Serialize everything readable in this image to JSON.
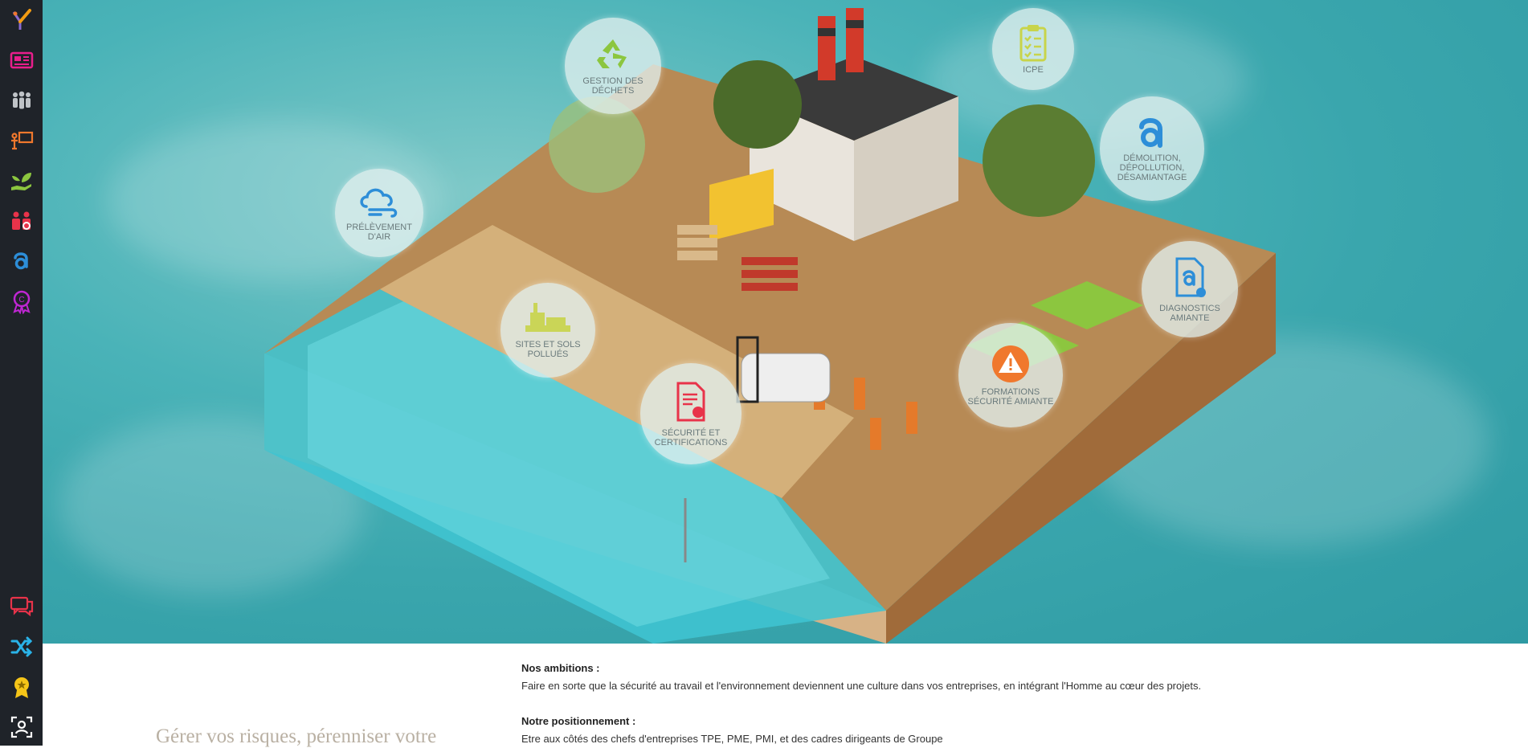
{
  "sidebar": {
    "items": [
      {
        "icon": "logo-icon",
        "color": "#f39c12"
      },
      {
        "icon": "newspaper-icon",
        "color": "#e91e8c"
      },
      {
        "icon": "team-icon",
        "color": "#bfc3c7"
      },
      {
        "icon": "presentation-icon",
        "color": "#f0782d"
      },
      {
        "icon": "plant-hand-icon",
        "color": "#8cc63f"
      },
      {
        "icon": "safety-group-icon",
        "color": "#e8334a"
      },
      {
        "icon": "asbestos-a-icon",
        "color": "#2d8ed8"
      },
      {
        "icon": "certification-badge-icon",
        "color": "#c026d3"
      },
      {
        "icon": "chat-icon",
        "color": "#e8334a"
      },
      {
        "icon": "shuffle-icon",
        "color": "#2ab3e8"
      },
      {
        "icon": "award-medal-icon",
        "color": "#f5c518"
      },
      {
        "icon": "profile-frame-icon",
        "color": "#ffffff"
      }
    ]
  },
  "hero": {
    "bubbles": [
      {
        "key": "dechets",
        "label": "GESTION DES DÉCHETS",
        "icon": "recycle-icon",
        "color": "#8cc63f"
      },
      {
        "key": "icpe",
        "label": "ICPE",
        "icon": "clipboard-check-icon",
        "color": "#c8d44a"
      },
      {
        "key": "demolition",
        "label": "DÉMOLITION, DÉPOLLUTION, DÉSAMIANTAGE",
        "icon": "asbestos-a-icon",
        "color": "#2d8ed8"
      },
      {
        "key": "air",
        "label": "PRÉLÈVEMENT D'AIR",
        "icon": "cloud-wind-icon",
        "color": "#2d8ed8"
      },
      {
        "key": "sites",
        "label": "SITES ET SOLS POLLUÉS",
        "icon": "industrial-site-icon",
        "color": "#c8d44a"
      },
      {
        "key": "diagnostics",
        "label": "DIAGNOSTICS AMIANTE",
        "icon": "document-a-icon",
        "color": "#2d8ed8"
      },
      {
        "key": "formations",
        "label": "FORMATIONS SÉCURITÉ AMIANTE",
        "icon": "warning-icon",
        "color": "#f0782d"
      },
      {
        "key": "securite",
        "label": "SÉCURITÉ ET CERTIFICATIONS",
        "icon": "certificate-icon",
        "color": "#e8334a"
      }
    ]
  },
  "content": {
    "tagline": "Gérer vos risques, pérenniser votre",
    "ambitions_title": "Nos ambitions :",
    "ambitions_text": "Faire en sorte que la sécurité au travail et l'environnement deviennent une culture dans vos entreprises, en intégrant l'Homme au cœur des projets.",
    "positionnement_title": "Notre positionnement :",
    "positionnement_text": "Etre aux côtés des chefs d'entreprises TPE, PME, PMI, et des cadres dirigeants de Groupe"
  }
}
